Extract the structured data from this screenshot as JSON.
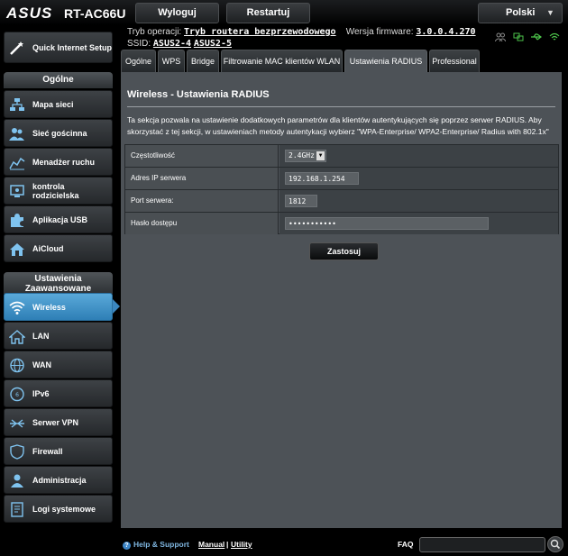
{
  "header": {
    "brand": "ASUS",
    "model": "RT-AC66U",
    "logout_label": "Wyloguj",
    "restart_label": "Restartuj",
    "language": "Polski",
    "mode_label": "Tryb operacji:",
    "mode_value": "Tryb routera bezprzewodowego",
    "fw_label": "Wersja firmware:",
    "fw_value": "3.0.0.4.270",
    "ssid_label": "SSID:",
    "ssid_1": "ASUS2-4",
    "ssid_2": "ASUS2-5"
  },
  "sidebar": {
    "quick_setup": "Quick Internet Setup",
    "general_header": "Ogólne",
    "general_items": [
      "Mapa sieci",
      "Sieć gościnna",
      "Menadżer ruchu",
      "kontrola rodzicielska",
      "Aplikacja USB",
      "AiCloud"
    ],
    "advanced_header": "Ustawienia Zaawansowane",
    "advanced_items": [
      "Wireless",
      "LAN",
      "WAN",
      "IPv6",
      "Serwer VPN",
      "Firewall",
      "Administracja",
      "Logi systemowe"
    ]
  },
  "tabs": [
    "Ogólne",
    "WPS",
    "Bridge",
    "Filtrowanie MAC klientów WLAN",
    "Ustawienia RADIUS",
    "Professional"
  ],
  "active_tab": "Ustawienia RADIUS",
  "main": {
    "title": "Wireless - Ustawienia RADIUS",
    "description": "Ta sekcja pozwala na ustawienie dodatkowych parametrów dla klientów autentykujących się poprzez serwer RADIUS. Aby skorzystać z tej sekcji, w ustawieniach metody autentykacji wybierz \"WPA-Enterprise/ WPA2-Enterprise/ Radius with 802.1x\"",
    "rows": [
      {
        "label": "Częstotliwość",
        "value": "2.4GHz"
      },
      {
        "label": "Adres IP serwera",
        "value": "192.168.1.254"
      },
      {
        "label": "Port serwera:",
        "value": "1812"
      },
      {
        "label": "Hasło dostępu",
        "value": "•••••••••••"
      }
    ],
    "apply_label": "Zastosuj"
  },
  "footer": {
    "help": "Help & Support",
    "manual": "Manual",
    "separator": "|",
    "utility": "Utility",
    "faq": "FAQ"
  },
  "colors": {
    "active_blue": "#3b87c0",
    "panel_bg": "#4d5257",
    "link_blue": "#7fb6e0"
  },
  "icons": [
    "client-list-icon",
    "network-icon",
    "usb-icon",
    "wifi-status-icon",
    "search-icon"
  ]
}
